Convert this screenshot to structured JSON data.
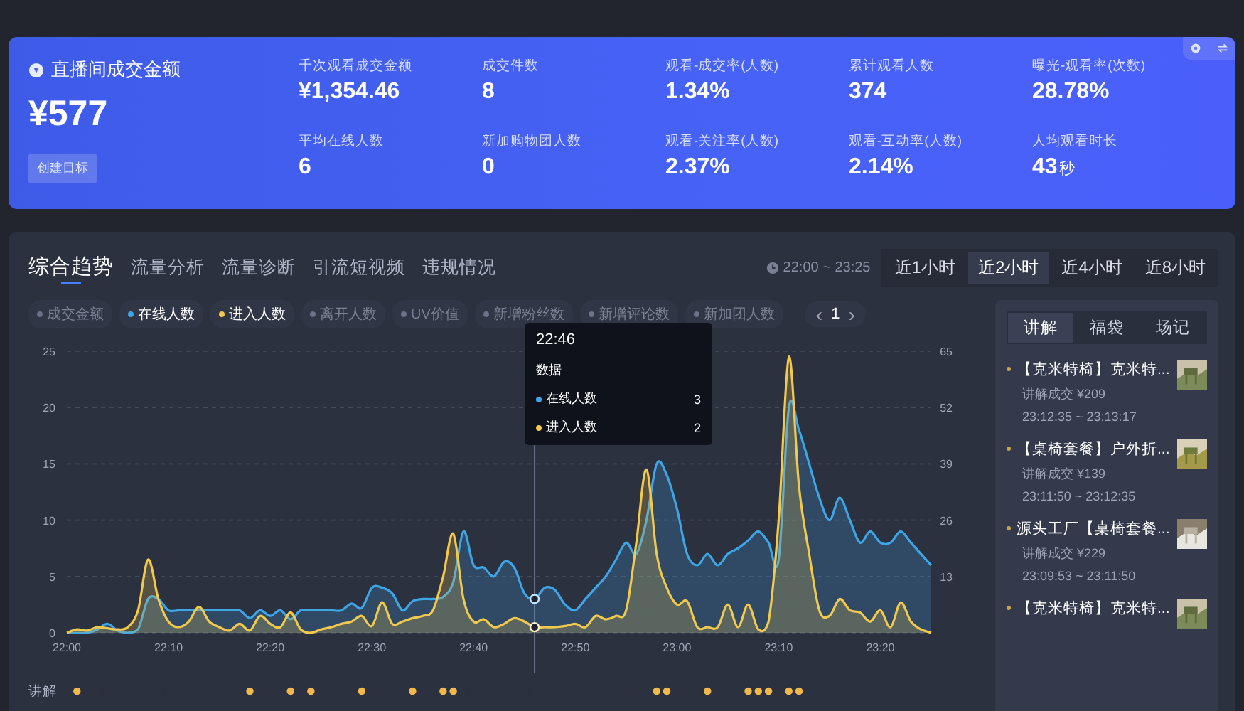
{
  "summary": {
    "title": "直播间成交金额",
    "value": "¥577",
    "button": "创建目标",
    "metrics": [
      {
        "label": "千次观看成交金额",
        "value": "¥1,354.46"
      },
      {
        "label": "成交件数",
        "value": "8"
      },
      {
        "label": "观看-成交率(人数)",
        "value": "1.34%"
      },
      {
        "label": "累计观看人数",
        "value": "374"
      },
      {
        "label": "曝光-观看率(次数)",
        "value": "28.78%"
      },
      {
        "label": "平均在线人数",
        "value": "6"
      },
      {
        "label": "新加购物团人数",
        "value": "0"
      },
      {
        "label": "观看-关注率(人数)",
        "value": "2.37%"
      },
      {
        "label": "观看-互动率(人数)",
        "value": "2.14%"
      },
      {
        "label": "人均观看时长",
        "value": "43",
        "unit": "秒"
      }
    ]
  },
  "panel": {
    "tabs": [
      {
        "label": "综合趋势",
        "selected": true
      },
      {
        "label": "流量分析",
        "selected": false
      },
      {
        "label": "流量诊断",
        "selected": false
      },
      {
        "label": "引流短视频",
        "selected": false
      },
      {
        "label": "违规情况",
        "selected": false
      }
    ],
    "time_range": "22:00 ~ 23:25",
    "range_buttons": [
      {
        "label": "近1小时",
        "selected": false
      },
      {
        "label": "近2小时",
        "selected": true
      },
      {
        "label": "近4小时",
        "selected": false
      },
      {
        "label": "近8小时",
        "selected": false
      }
    ],
    "legend": [
      {
        "label": "成交金额",
        "color": "#6b7186",
        "selected": false
      },
      {
        "label": "在线人数",
        "color": "#3ea6e6",
        "selected": true
      },
      {
        "label": "进入人数",
        "color": "#f2c94c",
        "selected": true
      },
      {
        "label": "离开人数",
        "color": "#6b7186",
        "selected": false
      },
      {
        "label": "UV价值",
        "color": "#6b7186",
        "selected": false
      },
      {
        "label": "新增粉丝数",
        "color": "#6b7186",
        "selected": false
      },
      {
        "label": "新增评论数",
        "color": "#6b7186",
        "selected": false
      },
      {
        "label": "新加团人数",
        "color": "#6b7186",
        "selected": false
      }
    ],
    "pager": {
      "prev": "‹",
      "page": "1",
      "next": "›"
    },
    "chart": {
      "tooltip": {
        "time": "22:46",
        "title": "数据",
        "rows": [
          {
            "value": "3"
          },
          {
            "value": "2"
          }
        ]
      },
      "chart_data": {
        "type": "area",
        "categories": [
          "22:00",
          null,
          null,
          null,
          null,
          null,
          null,
          null,
          null,
          null,
          "22:10",
          null,
          null,
          null,
          null,
          null,
          null,
          null,
          null,
          null,
          "22:20",
          null,
          null,
          null,
          null,
          null,
          null,
          null,
          null,
          null,
          "22:30",
          null,
          null,
          null,
          null,
          null,
          null,
          null,
          null,
          null,
          "22:40",
          null,
          null,
          null,
          null,
          null,
          null,
          null,
          null,
          null,
          "22:50",
          null,
          null,
          null,
          null,
          null,
          null,
          null,
          null,
          null,
          "23:00",
          null,
          null,
          null,
          null,
          null,
          null,
          null,
          null,
          null,
          "23:10",
          null,
          null,
          null,
          null,
          null,
          null,
          null,
          null,
          null,
          "23:20",
          null,
          null,
          null,
          null,
          null
        ],
        "series": [
          {
            "name": "在线人数",
            "color": "#3ea6e6",
            "values": [
              0,
              0,
              0,
              0.3,
              0.8,
              0.2,
              0,
              0.3,
              3,
              3,
              2,
              2,
              2,
              2,
              2,
              2,
              2,
              2,
              1.3,
              2,
              1.5,
              2,
              1.2,
              2,
              2,
              2,
              2,
              2,
              2.6,
              2.2,
              4,
              4,
              3.5,
              2,
              2.8,
              3,
              3,
              3.2,
              4.5,
              9,
              6,
              5.8,
              5,
              6.3,
              5.8,
              3.5,
              3,
              4,
              3.8,
              2.5,
              2,
              3,
              4,
              5,
              6.5,
              8,
              7,
              10,
              15,
              14,
              11,
              7,
              6,
              7,
              6,
              7,
              7.5,
              8.2,
              9,
              8,
              6.5,
              20,
              18,
              15,
              12,
              10,
              12,
              10,
              8,
              9,
              8,
              8,
              9,
              8,
              7,
              6
            ]
          },
          {
            "name": "进入人数",
            "color": "#f2c94c",
            "values": [
              0,
              0.3,
              0.2,
              0.5,
              0.4,
              0.3,
              0.5,
              2,
              6.5,
              3,
              1,
              0.5,
              1,
              2.3,
              1,
              0.5,
              0.2,
              0.8,
              0.2,
              1.5,
              0.8,
              0.5,
              1.8,
              0.3,
              0,
              0.3,
              0.5,
              0.8,
              1,
              1.5,
              0.6,
              2.7,
              0.8,
              1,
              1.3,
              1.5,
              2,
              5,
              8.8,
              3,
              1,
              1.2,
              0.5,
              0.8,
              1.3,
              1,
              0.5,
              0.5,
              0.5,
              0.6,
              0.8,
              0.5,
              1.5,
              1.2,
              1.5,
              2,
              8,
              14.5,
              7,
              4,
              2.5,
              2.8,
              0.5,
              0.5,
              0.5,
              2.5,
              0.5,
              2.5,
              0.3,
              1,
              10,
              24.5,
              13,
              7,
              2,
              1.5,
              3,
              2,
              1.8,
              1,
              2,
              0.5,
              2.7,
              1,
              0.3,
              0
            ]
          }
        ],
        "ylim": [
          0,
          25
        ],
        "yticks": [
          {
            "value": 0,
            "label": "0"
          },
          5,
          10,
          15,
          20,
          25
        ],
        "y2lim": [
          0,
          65
        ],
        "y2ticks": [
          13,
          26,
          39,
          52,
          65
        ],
        "grid": true
      },
      "explain_label": "讲解",
      "minutes": [
        {
          "explain": false,
          "hover": false
        },
        {
          "explain": true,
          "hover": false
        },
        {
          "explain": false,
          "hover": false
        },
        {
          "explain": false,
          "hover": false
        },
        {
          "explain": false,
          "hover": false
        },
        {
          "explain": false,
          "hover": false
        },
        {
          "explain": false,
          "hover": false
        },
        {
          "explain": false,
          "hover": false
        },
        {
          "explain": false,
          "hover": false
        },
        {
          "explain": false,
          "hover": false
        },
        {
          "explain": false,
          "hover": false
        },
        {
          "explain": false,
          "hover": false
        },
        {
          "explain": false,
          "hover": false
        },
        {
          "explain": false,
          "hover": false
        },
        {
          "explain": false,
          "hover": false
        },
        {
          "explain": false,
          "hover": false
        },
        {
          "explain": false,
          "hover": false
        },
        {
          "explain": false,
          "hover": false
        },
        {
          "explain": true,
          "hover": false
        },
        {
          "explain": false,
          "hover": false
        },
        {
          "explain": false,
          "hover": false
        },
        {
          "explain": false,
          "hover": false
        },
        {
          "explain": true,
          "hover": false
        },
        {
          "explain": false,
          "hover": false
        },
        {
          "explain": true,
          "hover": false
        },
        {
          "explain": false,
          "hover": false
        },
        {
          "explain": false,
          "hover": false
        },
        {
          "explain": false,
          "hover": false
        },
        {
          "explain": false,
          "hover": false
        },
        {
          "explain": true,
          "hover": false
        },
        {
          "explain": false,
          "hover": false
        },
        {
          "explain": false,
          "hover": false
        },
        {
          "explain": false,
          "hover": false
        },
        {
          "explain": false,
          "hover": false
        },
        {
          "explain": true,
          "hover": false
        },
        {
          "explain": false,
          "hover": false
        },
        {
          "explain": false,
          "hover": false
        },
        {
          "explain": true,
          "hover": false
        },
        {
          "explain": true,
          "hover": false
        },
        {
          "explain": false,
          "hover": false
        },
        {
          "explain": false,
          "hover": false
        },
        {
          "explain": false,
          "hover": false
        },
        {
          "explain": false,
          "hover": false
        },
        {
          "explain": false,
          "hover": false
        },
        {
          "explain": false,
          "hover": false
        },
        {
          "explain": false,
          "hover": false
        },
        {
          "explain": false,
          "hover": true
        },
        {
          "explain": false,
          "hover": false
        },
        {
          "explain": false,
          "hover": false
        },
        {
          "explain": false,
          "hover": false
        },
        {
          "explain": false,
          "hover": false
        },
        {
          "explain": false,
          "hover": false
        },
        {
          "explain": false,
          "hover": false
        },
        {
          "explain": false,
          "hover": false
        },
        {
          "explain": false,
          "hover": false
        },
        {
          "explain": false,
          "hover": false
        },
        {
          "explain": false,
          "hover": false
        },
        {
          "explain": false,
          "hover": false
        },
        {
          "explain": true,
          "hover": false
        },
        {
          "explain": true,
          "hover": false
        },
        {
          "explain": false,
          "hover": false
        },
        {
          "explain": false,
          "hover": false
        },
        {
          "explain": false,
          "hover": false
        },
        {
          "explain": true,
          "hover": false
        },
        {
          "explain": false,
          "hover": false
        },
        {
          "explain": false,
          "hover": false
        },
        {
          "explain": false,
          "hover": false
        },
        {
          "explain": true,
          "hover": false
        },
        {
          "explain": true,
          "hover": false
        },
        {
          "explain": true,
          "hover": false
        },
        {
          "explain": false,
          "hover": false
        },
        {
          "explain": true,
          "hover": false
        },
        {
          "explain": true,
          "hover": false
        },
        {
          "explain": false,
          "hover": false
        },
        {
          "explain": false,
          "hover": false
        },
        {
          "explain": false,
          "hover": false
        },
        {
          "explain": false,
          "hover": false
        },
        {
          "explain": false,
          "hover": false
        },
        {
          "explain": false,
          "hover": false
        },
        {
          "explain": false,
          "hover": false
        },
        {
          "explain": false,
          "hover": false
        },
        {
          "explain": false,
          "hover": false
        },
        {
          "explain": false,
          "hover": false
        },
        {
          "explain": false,
          "hover": false
        },
        {
          "explain": false,
          "hover": false
        },
        {
          "explain": false,
          "hover": false
        }
      ]
    },
    "sidebar": {
      "tabs": [
        {
          "label": "讲解",
          "selected": true
        },
        {
          "label": "福袋",
          "selected": false
        },
        {
          "label": "场记",
          "selected": false
        }
      ],
      "items": [
        {
          "title": "【克米特椅】克米特...",
          "sale": "讲解成交 ¥209",
          "time": "23:12:35 ~ 23:13:17"
        },
        {
          "title": "【桌椅套餐】户外折...",
          "sale": "讲解成交 ¥139",
          "time": "23:11:50 ~ 23:12:35"
        },
        {
          "title": "源头工厂【桌椅套餐...",
          "sale": "讲解成交 ¥229",
          "time": "23:09:53 ~ 23:11:50"
        },
        {
          "title": "【克米特椅】克米特..."
        }
      ]
    }
  }
}
